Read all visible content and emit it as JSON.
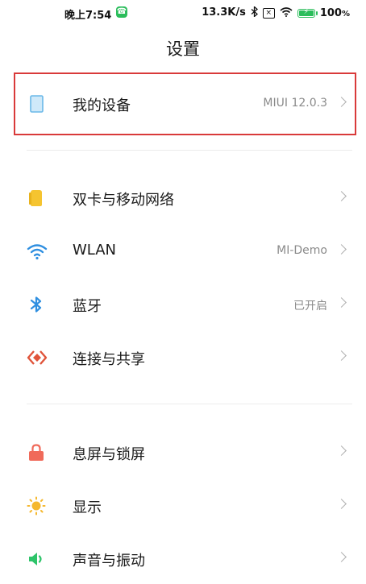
{
  "status_bar": {
    "time": "晚上7:54",
    "network_speed": "13.3K/s",
    "battery_level": "100",
    "battery_unit": "%",
    "icons": [
      "phone-call-icon",
      "bluetooth-icon",
      "no-sim-icon",
      "wifi-icon",
      "battery-charging-icon"
    ]
  },
  "header": {
    "title": "设置"
  },
  "settings": {
    "my_device": {
      "label": "我的设备",
      "value": "MIUI 12.0.3",
      "icon": "tablet-icon",
      "icon_color": "#6ab8e8"
    },
    "dual_sim": {
      "label": "双卡与移动网络",
      "value": "",
      "icon": "sim-card-icon",
      "icon_color": "#f5c430"
    },
    "wlan": {
      "label": "WLAN",
      "value": "MI-Demo",
      "icon": "wifi-icon",
      "icon_color": "#2f8fe0"
    },
    "bluetooth": {
      "label": "蓝牙",
      "value": "已开启",
      "icon": "bluetooth-icon",
      "icon_color": "#2f8fe0"
    },
    "connection_sharing": {
      "label": "连接与共享",
      "value": "",
      "icon": "share-icon",
      "icon_color": "#e0543a"
    },
    "lock_screen": {
      "label": "息屏与锁屏",
      "value": "",
      "icon": "lock-icon",
      "icon_color": "#f06a5a"
    },
    "display": {
      "label": "显示",
      "value": "",
      "icon": "sun-icon",
      "icon_color": "#f5b82e"
    },
    "sound": {
      "label": "声音与振动",
      "value": "",
      "icon": "speaker-icon",
      "icon_color": "#2ec46a"
    }
  },
  "colors": {
    "highlight_border": "#d93a3a",
    "chevron": "#b0b0b0",
    "secondary_text": "#8a8a8a"
  }
}
